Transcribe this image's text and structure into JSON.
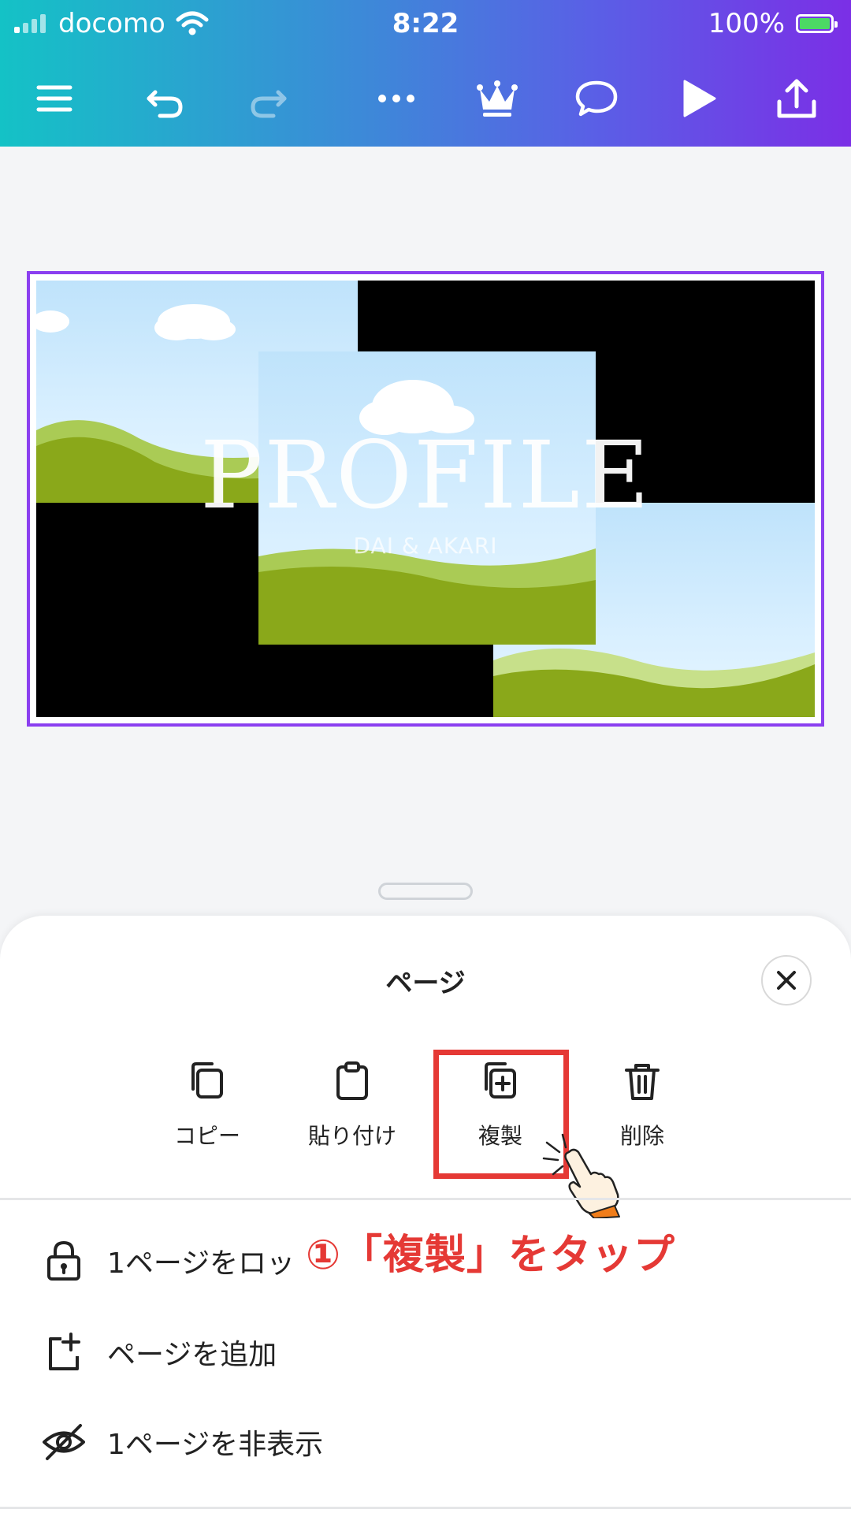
{
  "status_bar": {
    "carrier": "docomo",
    "time": "8:22",
    "battery": "100%"
  },
  "toolbar": {
    "icons": [
      "menu-icon",
      "undo-icon",
      "redo-icon",
      "more-icon",
      "crown-icon",
      "comment-icon",
      "play-icon",
      "share-icon"
    ]
  },
  "design": {
    "title": "PROFILE",
    "subtitle": "DAI & AKARI"
  },
  "sheet": {
    "title": "ページ",
    "actions": [
      {
        "label": "コピー",
        "icon": "copy-icon"
      },
      {
        "label": "貼り付け",
        "icon": "paste-icon"
      },
      {
        "label": "複製",
        "icon": "duplicate-icon"
      },
      {
        "label": "削除",
        "icon": "trash-icon"
      }
    ],
    "rows": [
      {
        "label": "1ページをロッ",
        "icon": "lock-icon"
      },
      {
        "label": "ページを追加",
        "icon": "add-page-icon"
      },
      {
        "label": "1ページを非表示",
        "icon": "hide-icon"
      }
    ]
  },
  "annotation": {
    "callout": "①「複製」をタップ"
  },
  "colors": {
    "accent": "#8b3ff0",
    "highlight": "#e53935"
  }
}
